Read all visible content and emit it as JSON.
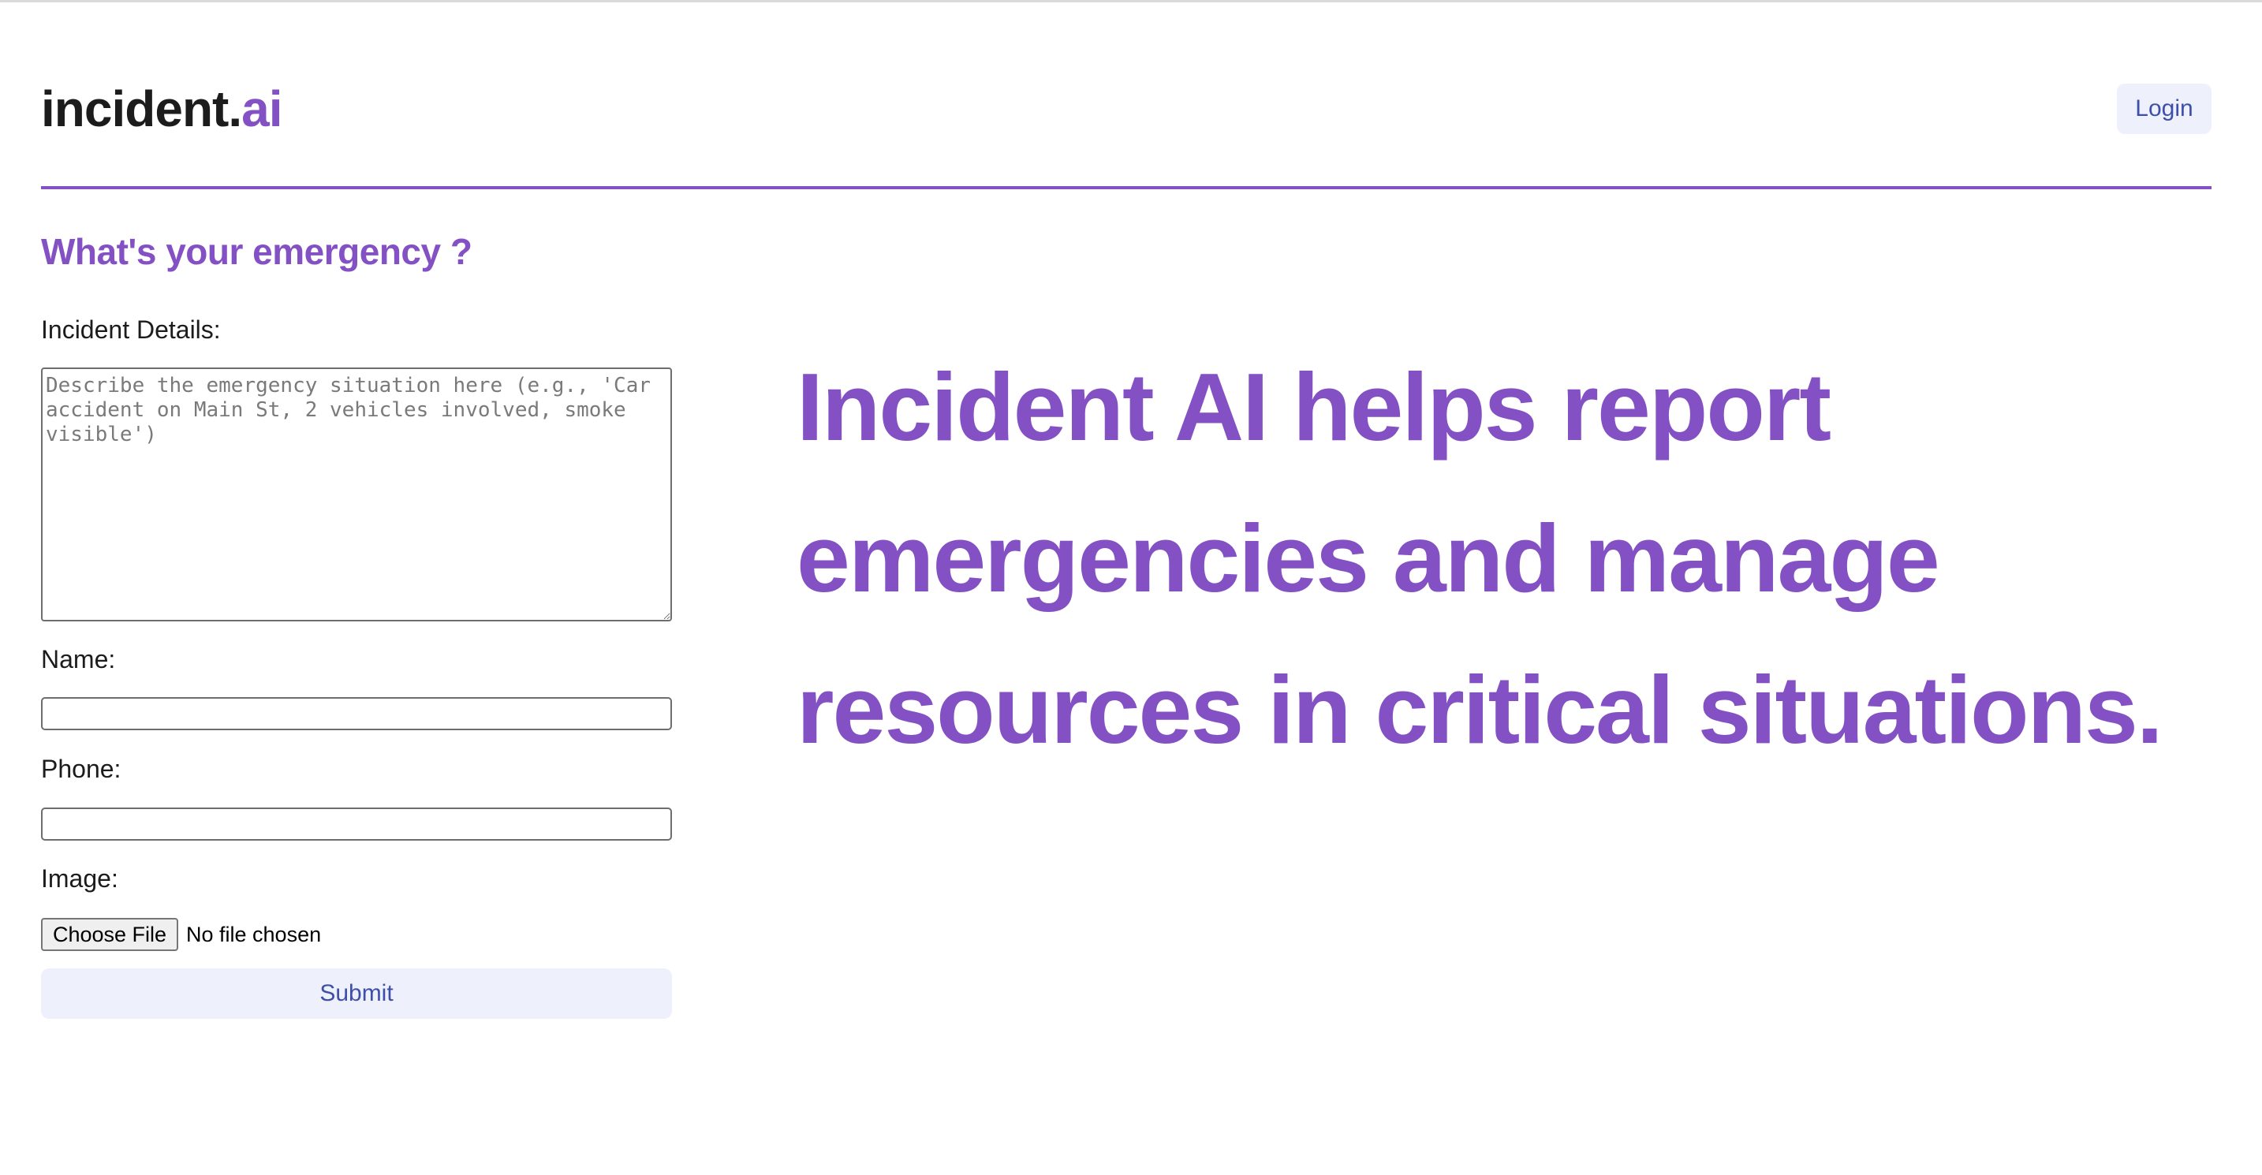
{
  "brand": {
    "name": "incident.",
    "accent": "ai"
  },
  "header": {
    "login_label": "Login"
  },
  "form": {
    "title": "What's your emergency ?",
    "details_label": "Incident Details:",
    "details_placeholder": "Describe the emergency situation here (e.g., 'Car accident on Main St, 2 vehicles involved, smoke visible')",
    "name_label": "Name:",
    "phone_label": "Phone:",
    "image_label": "Image:",
    "choose_file_label": "Choose File",
    "file_status": "No file chosen",
    "submit_label": "Submit"
  },
  "hero": {
    "tagline": "Incident AI helps report emergencies and manage resources in critical situations."
  },
  "colors": {
    "accent": "#8451c4",
    "button_bg": "#eef1fb",
    "button_text": "#3d4fa8"
  }
}
